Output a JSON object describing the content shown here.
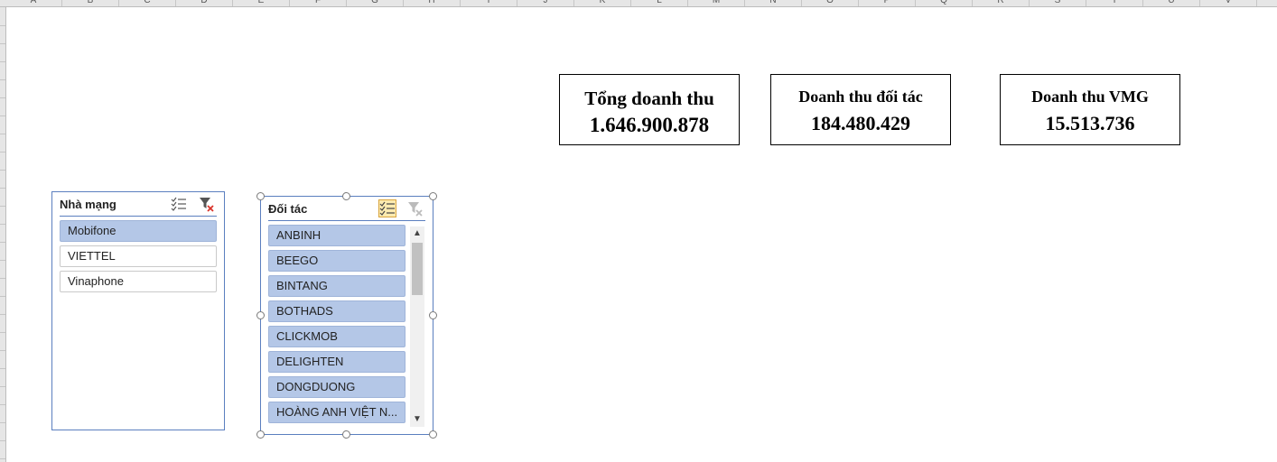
{
  "column_headers": [
    "A",
    "B",
    "C",
    "D",
    "E",
    "F",
    "G",
    "H",
    "I",
    "J",
    "K",
    "L",
    "M",
    "N",
    "O",
    "P",
    "Q",
    "R",
    "S",
    "T",
    "U",
    "V"
  ],
  "kpis": [
    {
      "title": "Tổng doanh thu",
      "value": "1.646.900.878"
    },
    {
      "title": "Doanh thu đối tác",
      "value": "184.480.429"
    },
    {
      "title": "Doanh thu VMG",
      "value": "15.513.736"
    }
  ],
  "slicer_network": {
    "title": "Nhà mạng",
    "multi_select_icon": "multi-select-icon",
    "clear_filter_icon": "clear-filter-icon",
    "items": [
      {
        "label": "Mobifone",
        "selected": true
      },
      {
        "label": "VIETTEL",
        "selected": false
      },
      {
        "label": "Vinaphone",
        "selected": false
      }
    ]
  },
  "slicer_partner": {
    "title": "Đối tác",
    "multi_select_icon": "multi-select-icon",
    "clear_filter_icon": "clear-filter-icon",
    "items": [
      {
        "label": "ANBINH",
        "selected": true
      },
      {
        "label": "BEEGO",
        "selected": true
      },
      {
        "label": "BINTANG",
        "selected": true
      },
      {
        "label": "BOTHADS",
        "selected": true
      },
      {
        "label": "CLICKMOB",
        "selected": true
      },
      {
        "label": "DELIGHTEN",
        "selected": true
      },
      {
        "label": "DONGDUONG",
        "selected": true
      },
      {
        "label": "HOÀNG ANH VIỆT N...",
        "selected": true
      }
    ]
  },
  "colors": {
    "selected_item": "#b4c7e7",
    "slicer_border": "#5b7fbf",
    "multi_select_active": "#fcebb0"
  }
}
